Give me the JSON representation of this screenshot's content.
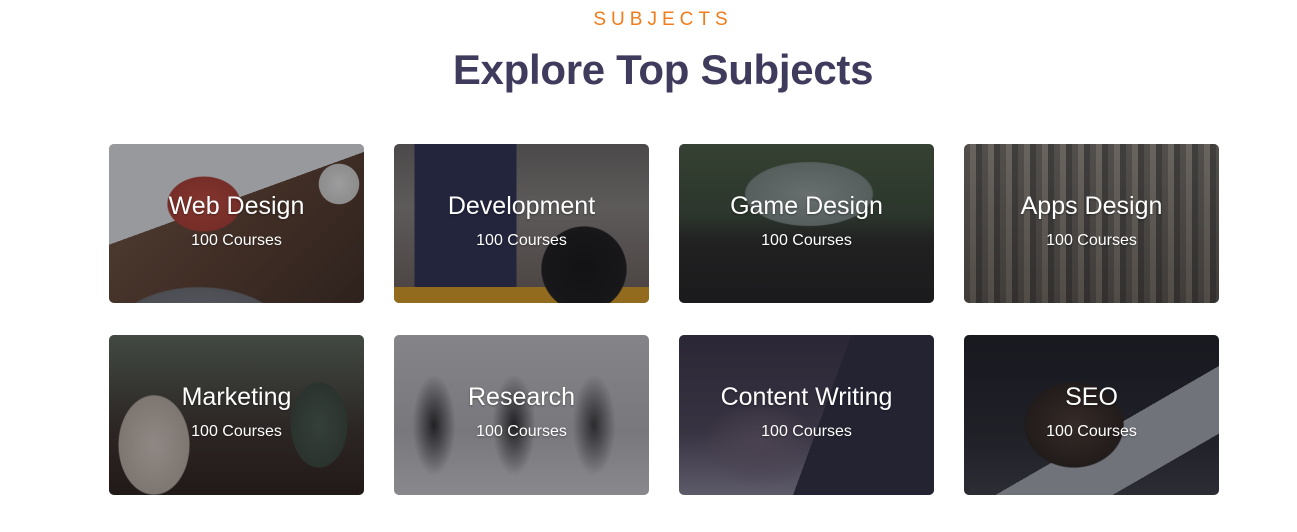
{
  "header": {
    "eyebrow": "SUBJECTS",
    "title": "Explore Top Subjects"
  },
  "colors": {
    "eyebrow": "#f07c1b",
    "title": "#3f3b5c",
    "card_text": "#ffffff"
  },
  "subjects": [
    {
      "title": "Web Design",
      "count": "100 Courses",
      "image": "laptop-typing-photo"
    },
    {
      "title": "Development",
      "count": "100 Courses",
      "image": "graduate-video-call-photo"
    },
    {
      "title": "Game Design",
      "count": "100 Courses",
      "image": "desk-monitor-lecture-photo"
    },
    {
      "title": "Apps Design",
      "count": "100 Courses",
      "image": "students-library-photo"
    },
    {
      "title": "Marketing",
      "count": "100 Courses",
      "image": "team-meeting-photo"
    },
    {
      "title": "Research",
      "count": "100 Courses",
      "image": "group-standing-discussion-photo"
    },
    {
      "title": "Content Writing",
      "count": "100 Courses",
      "image": "writing-notebook-photo"
    },
    {
      "title": "SEO",
      "count": "100 Courses",
      "image": "man-laptop-thinking-photo"
    }
  ]
}
